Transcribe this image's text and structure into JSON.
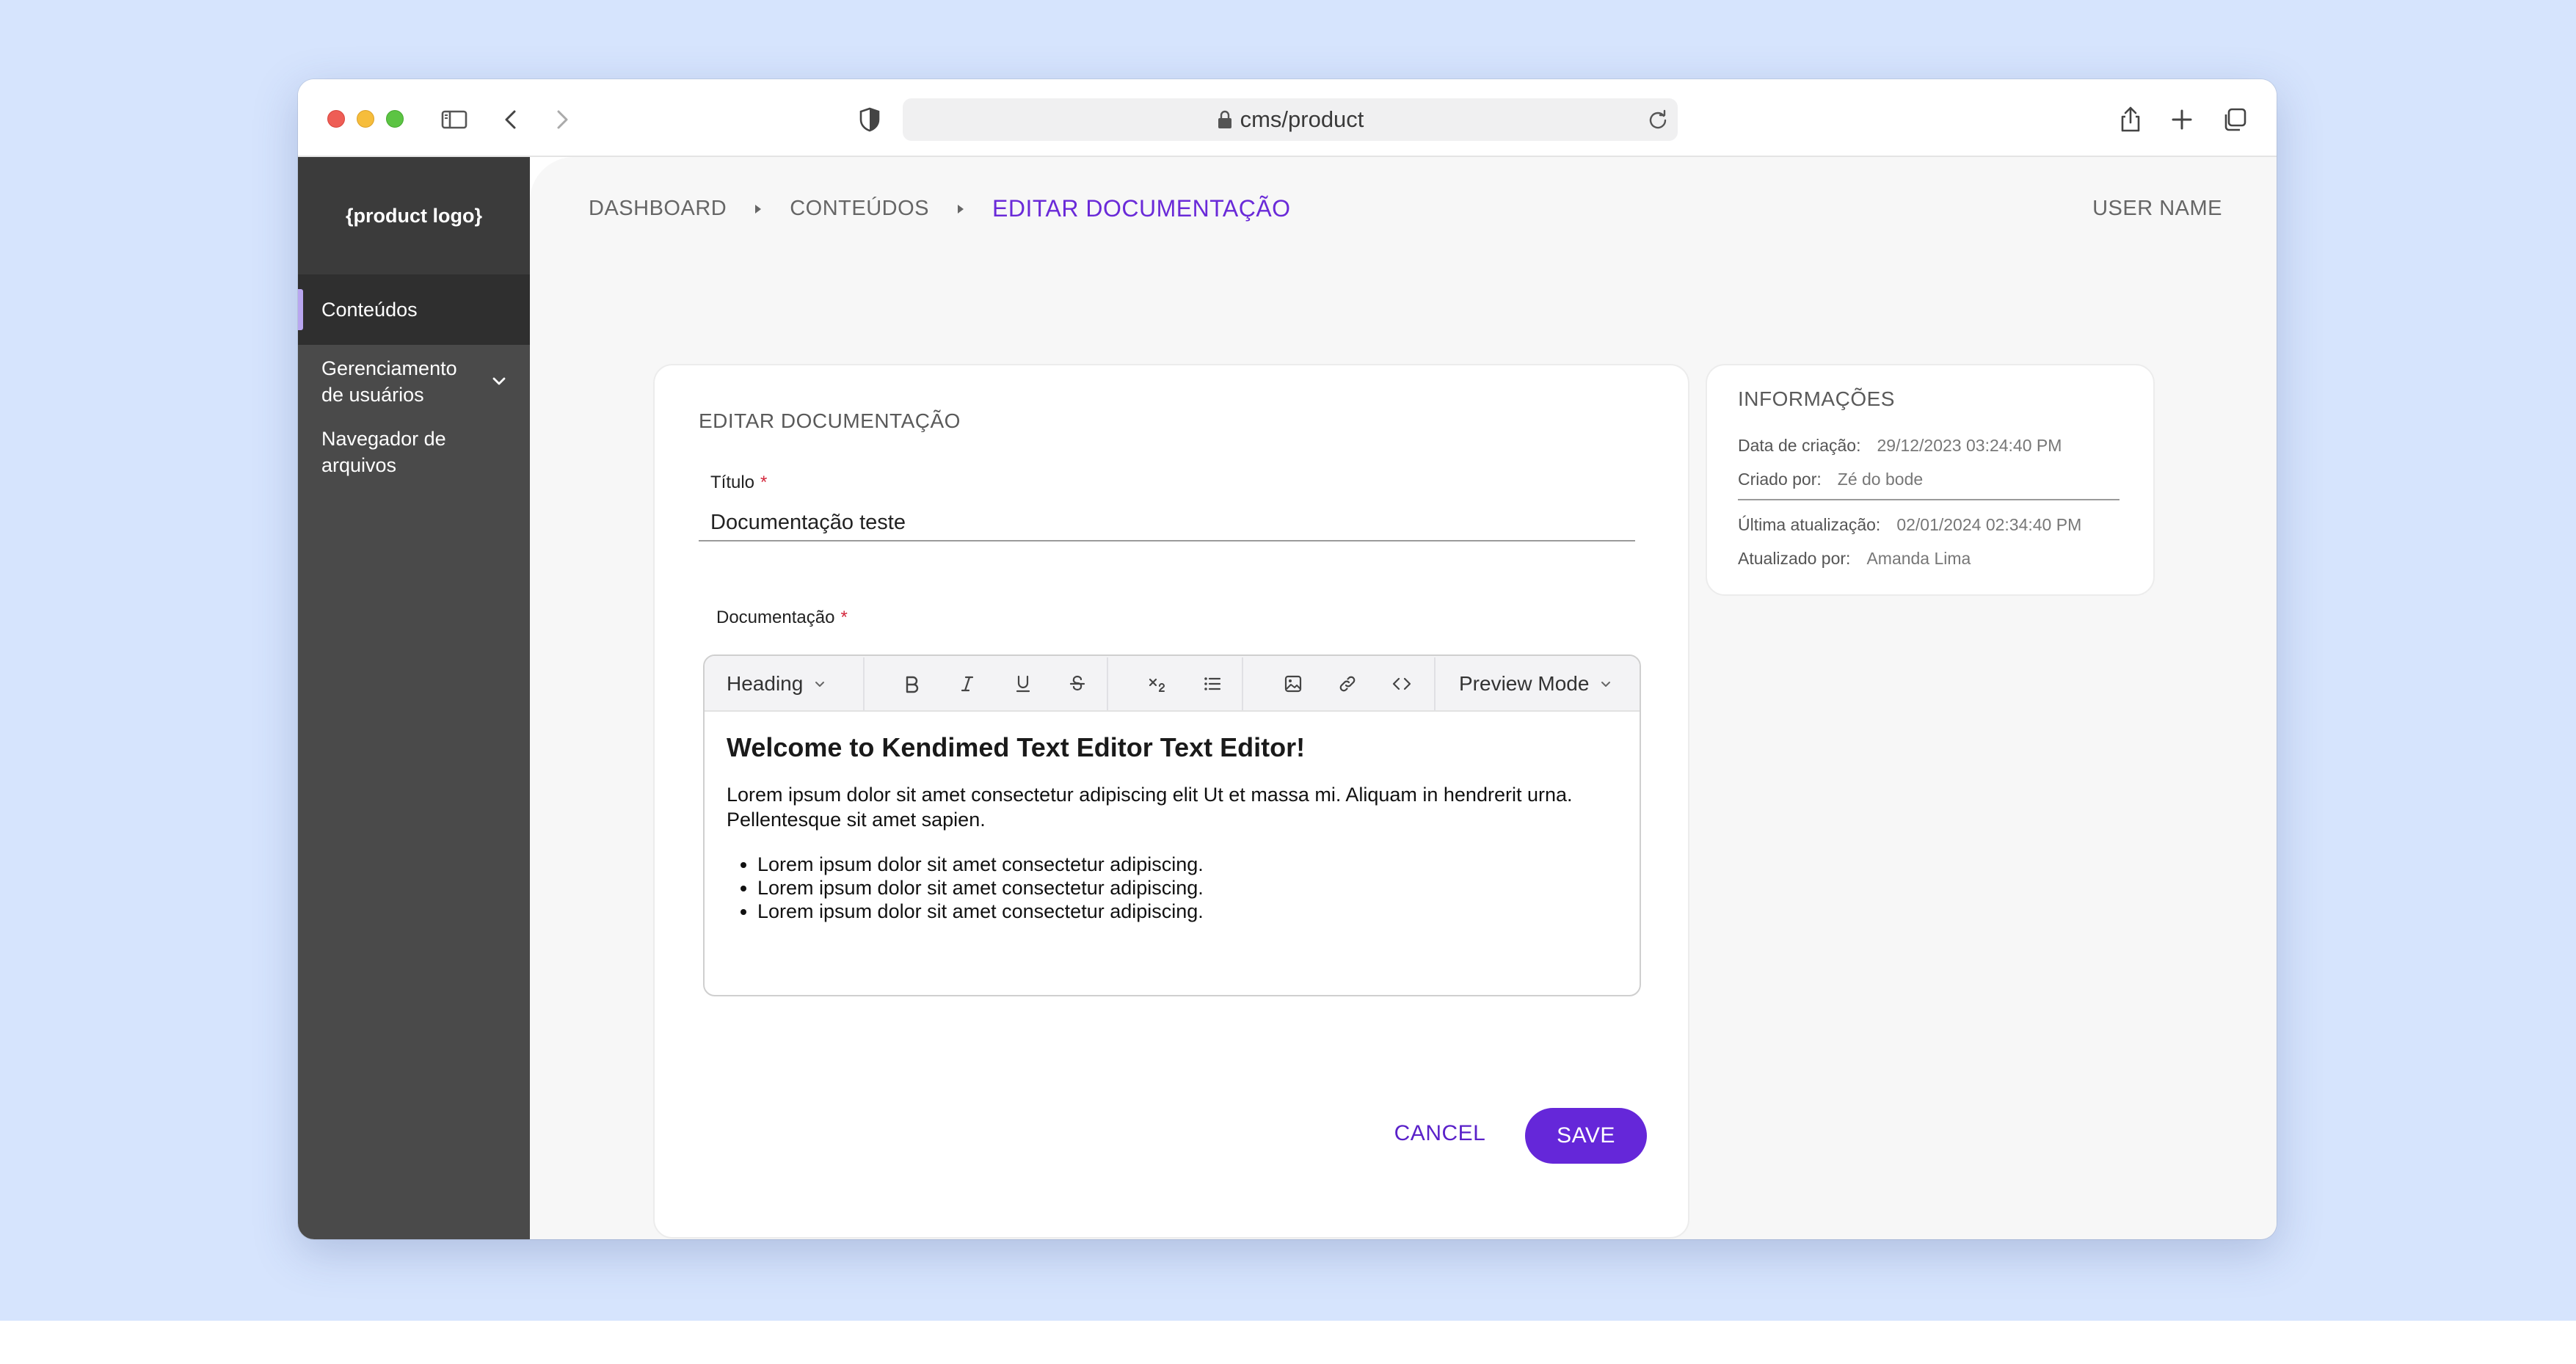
{
  "browser": {
    "url": "cms/product"
  },
  "sidebar": {
    "logo": "{product logo}",
    "items": [
      {
        "label": "Conteúdos"
      },
      {
        "label": "Gerenciamento de usuários"
      },
      {
        "label": "Navegador de arquivos"
      }
    ]
  },
  "header": {
    "breadcrumb": [
      "DASHBOARD",
      "CONTEÚDOS",
      "EDITAR DOCUMENTAÇÃO"
    ],
    "user_name": "USER NAME"
  },
  "form": {
    "title": "EDITAR DOCUMENTAÇÃO",
    "titulo_label": "Título",
    "titulo_value": "Documentação teste",
    "doc_label": "Documentação",
    "required_mark": "*",
    "toolbar": {
      "heading_select": "Heading",
      "preview_select": "Preview Mode"
    },
    "editor": {
      "heading": "Welcome to Kendimed Text Editor Text Editor!",
      "paragraph": "Lorem ipsum dolor sit amet consectetur adipiscing elit Ut et massa mi. Aliquam in hendrerit urna. Pellentesque sit amet sapien.",
      "list": [
        "Lorem ipsum dolor sit amet consectetur adipiscing.",
        "Lorem ipsum dolor sit amet consectetur adipiscing.",
        "Lorem ipsum dolor sit amet consectetur adipiscing."
      ]
    },
    "cancel_label": "CANCEL",
    "save_label": "SAVE"
  },
  "info": {
    "title": "INFORMAÇÕES",
    "created_label": "Data de criação:",
    "created_value": "29/12/2023 03:24:40 PM",
    "created_by_label": "Criado por:",
    "created_by_value": "Zé do bode",
    "updated_label": "Última atualização:",
    "updated_value": "02/01/2024 02:34:40 PM",
    "updated_by_label": "Atualizado por:",
    "updated_by_value": "Amanda Lima"
  },
  "colors": {
    "accent": "#6527d9",
    "sidebar": "#4a4a4a",
    "background": "#d6e4fd"
  }
}
